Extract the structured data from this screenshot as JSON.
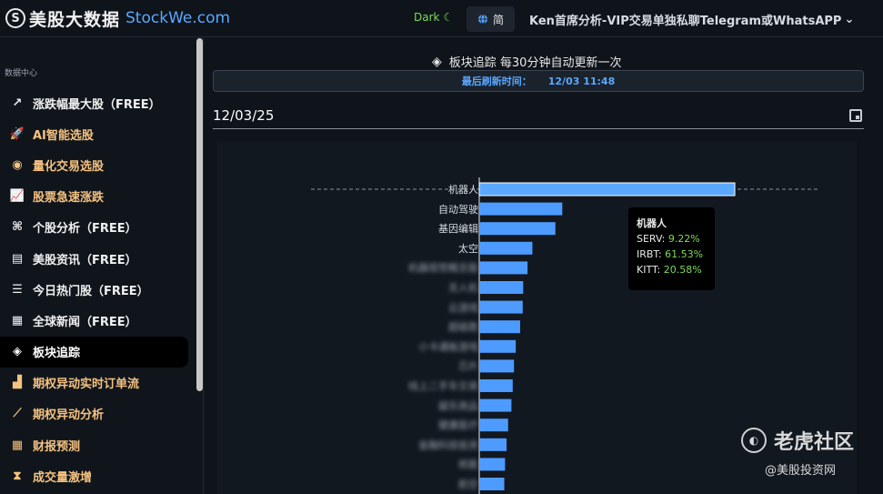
{
  "header": {
    "logo_mark": "S",
    "brand": "美股大数据",
    "domain": "StockWe.com",
    "theme_label": "Dark",
    "theme_icon": "moon-icon",
    "lang_label": "简",
    "lang_icon": "globe-icon",
    "promo": "Ken首席分析-VIP交易单独私聊Telegram或WhatsAPP",
    "promo_icon": "chevron-down-icon"
  },
  "sidebar": {
    "section": "数据中心",
    "items": [
      {
        "label": "涨跌幅最大股（FREE）",
        "icon": "trend-up-icon",
        "glyph": "↗",
        "kind": "free"
      },
      {
        "label": "AI智能选股",
        "icon": "rocket-icon",
        "glyph": "🚀",
        "kind": "paid"
      },
      {
        "label": "量化交易选股",
        "icon": "robot-icon",
        "glyph": "◉",
        "kind": "paid"
      },
      {
        "label": "股票急速涨跌",
        "icon": "line-chart-icon",
        "glyph": "📈",
        "kind": "paid"
      },
      {
        "label": "个股分析（FREE）",
        "icon": "binoculars-icon",
        "glyph": "⌘",
        "kind": "free"
      },
      {
        "label": "美股资讯（FREE）",
        "icon": "newspaper-icon",
        "glyph": "▤",
        "kind": "free"
      },
      {
        "label": "今日热门股（FREE）",
        "icon": "list-icon",
        "glyph": "☰",
        "kind": "free"
      },
      {
        "label": "全球新闻（FREE）",
        "icon": "news-icon",
        "glyph": "▦",
        "kind": "free"
      },
      {
        "label": "板块追踪",
        "icon": "layers-icon",
        "glyph": "◈",
        "kind": "active"
      },
      {
        "label": "期权异动实时订单流",
        "icon": "area-chart-icon",
        "glyph": "▟",
        "kind": "paid"
      },
      {
        "label": "期权异动分析",
        "icon": "chart-line-icon",
        "glyph": "⟋",
        "kind": "paid"
      },
      {
        "label": "财报预测",
        "icon": "calendar-icon",
        "glyph": "▦",
        "kind": "paid"
      },
      {
        "label": "成交量激增",
        "icon": "hourglass-icon",
        "glyph": "⧗",
        "kind": "paid"
      }
    ]
  },
  "main": {
    "section_title": "板块追踪 每30分钟自动更新一次",
    "section_icon": "layers-icon",
    "refresh_label": "最后刷新时间：",
    "refresh_time": "12/03 11:48",
    "date_value": "12/03/25",
    "date_icon": "calendar-icon"
  },
  "chart_data": {
    "type": "bar",
    "orientation": "horizontal",
    "categories": [
      "机器人",
      "自动驾驶",
      "基因编辑",
      "太空",
      "",
      "",
      "",
      "",
      "",
      "",
      "",
      "",
      "",
      "",
      "",
      ""
    ],
    "values": [
      100,
      32.5,
      29.8,
      20.8,
      18.9,
      17.2,
      17.0,
      16.0,
      14.3,
      13.6,
      13.1,
      12.6,
      11.3,
      10.7,
      10.1,
      9.8
    ],
    "xlim": [
      0,
      100
    ],
    "bar_color": "#4e9bff",
    "tooltip": {
      "title": "机器人",
      "rows": [
        {
          "ticker": "SERV:",
          "pct": "9.22%"
        },
        {
          "ticker": "IRBT:",
          "pct": "61.53%"
        },
        {
          "ticker": "KITT:",
          "pct": "20.58%"
        }
      ]
    }
  },
  "watermark": {
    "brand": "老虎社区",
    "sub": "@美股投资网",
    "icon": "tiger-logo-icon"
  }
}
